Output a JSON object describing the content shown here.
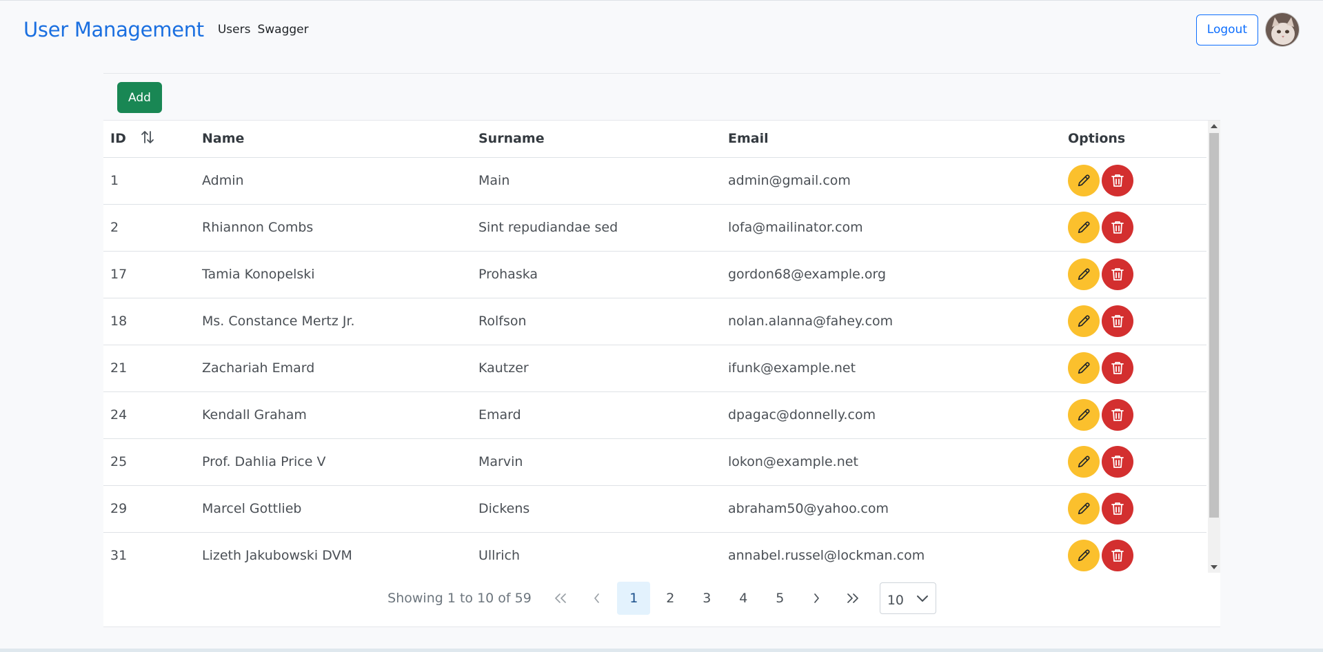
{
  "navbar": {
    "brand": "User Management",
    "links": [
      "Users",
      "Swagger"
    ],
    "logout_label": "Logout"
  },
  "toolbar": {
    "add_label": "Add"
  },
  "table": {
    "headers": {
      "id": "ID",
      "name": "Name",
      "surname": "Surname",
      "email": "Email",
      "options": "Options"
    },
    "rows": [
      {
        "id": "1",
        "name": "Admin",
        "surname": "Main",
        "email": "admin@gmail.com"
      },
      {
        "id": "2",
        "name": "Rhiannon Combs",
        "surname": "Sint repudiandae sed",
        "email": "lofa@mailinator.com"
      },
      {
        "id": "17",
        "name": "Tamia Konopelski",
        "surname": "Prohaska",
        "email": "gordon68@example.org"
      },
      {
        "id": "18",
        "name": "Ms. Constance Mertz Jr.",
        "surname": "Rolfson",
        "email": "nolan.alanna@fahey.com"
      },
      {
        "id": "21",
        "name": "Zachariah Emard",
        "surname": "Kautzer",
        "email": "ifunk@example.net"
      },
      {
        "id": "24",
        "name": "Kendall Graham",
        "surname": "Emard",
        "email": "dpagac@donnelly.com"
      },
      {
        "id": "25",
        "name": "Prof. Dahlia Price V",
        "surname": "Marvin",
        "email": "lokon@example.net"
      },
      {
        "id": "29",
        "name": "Marcel Gottlieb",
        "surname": "Dickens",
        "email": "abraham50@yahoo.com"
      },
      {
        "id": "31",
        "name": "Lizeth Jakubowski DVM",
        "surname": "Ullrich",
        "email": "annabel.russel@lockman.com"
      }
    ]
  },
  "pagination": {
    "showing": "Showing 1 to 10 of 59",
    "pages": [
      "1",
      "2",
      "3",
      "4",
      "5"
    ],
    "active_page": "1",
    "rows_per_page": "10"
  },
  "colors": {
    "brand": "#1a6fe0",
    "add_button": "#198754",
    "edit_button": "#fbc02d",
    "delete_button": "#d32f2f",
    "logout_border": "#0d6efd"
  },
  "icons": {
    "sort": "sort-up-down-icon",
    "edit": "pencil-icon",
    "delete": "trash-icon",
    "first": "double-chevron-left-icon",
    "prev": "chevron-left-icon",
    "next": "chevron-right-icon",
    "last": "double-chevron-right-icon",
    "dropdown": "chevron-down-icon"
  }
}
